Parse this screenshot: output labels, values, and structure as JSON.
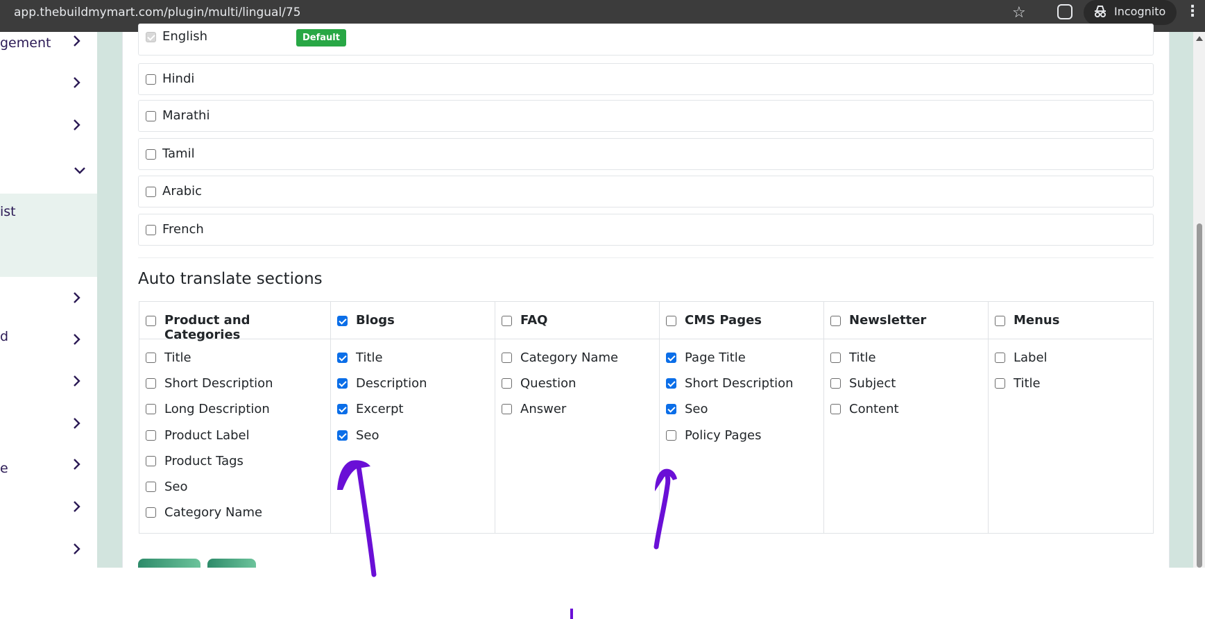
{
  "browser": {
    "url": "app.thebuildmymart.com/plugin/multi/lingual/75",
    "incognito_label": "Incognito"
  },
  "sidebar": {
    "items": [
      {
        "label": "gement"
      },
      {
        "label": ""
      },
      {
        "label": ""
      },
      {
        "label": ""
      },
      {
        "label": "ist"
      },
      {
        "label": ""
      },
      {
        "label": "d"
      },
      {
        "label": ""
      },
      {
        "label": ""
      },
      {
        "label": "e"
      },
      {
        "label": ""
      },
      {
        "label": ""
      }
    ]
  },
  "languages": [
    {
      "label": "English",
      "checked": true,
      "disabled": true,
      "badge": "Default"
    },
    {
      "label": "Hindi",
      "checked": false
    },
    {
      "label": "Marathi",
      "checked": false
    },
    {
      "label": "Tamil",
      "checked": false
    },
    {
      "label": "Arabic",
      "checked": false
    },
    {
      "label": "French",
      "checked": false
    }
  ],
  "auto_translate": {
    "title": "Auto translate sections",
    "columns": [
      {
        "heading": "Product and Categories",
        "checked": false,
        "items": [
          {
            "label": "Title",
            "checked": false
          },
          {
            "label": "Short Description",
            "checked": false
          },
          {
            "label": "Long Description",
            "checked": false
          },
          {
            "label": "Product Label",
            "checked": false
          },
          {
            "label": "Product Tags",
            "checked": false
          },
          {
            "label": "Seo",
            "checked": false
          },
          {
            "label": "Category Name",
            "checked": false
          }
        ]
      },
      {
        "heading": "Blogs",
        "checked": true,
        "items": [
          {
            "label": "Title",
            "checked": true
          },
          {
            "label": "Description",
            "checked": true
          },
          {
            "label": "Excerpt",
            "checked": true
          },
          {
            "label": "Seo",
            "checked": true
          }
        ]
      },
      {
        "heading": "FAQ",
        "checked": false,
        "items": [
          {
            "label": "Category Name",
            "checked": false
          },
          {
            "label": "Question",
            "checked": false
          },
          {
            "label": "Answer",
            "checked": false
          }
        ]
      },
      {
        "heading": "CMS Pages",
        "checked": false,
        "items": [
          {
            "label": "Page Title",
            "checked": true
          },
          {
            "label": "Short Description",
            "checked": true
          },
          {
            "label": "Seo",
            "checked": true
          },
          {
            "label": "Policy Pages",
            "checked": false
          }
        ]
      },
      {
        "heading": "Newsletter",
        "checked": false,
        "items": [
          {
            "label": "Title",
            "checked": false
          },
          {
            "label": "Subject",
            "checked": false
          },
          {
            "label": "Content",
            "checked": false
          }
        ]
      },
      {
        "heading": "Menus",
        "checked": false,
        "items": [
          {
            "label": "Label",
            "checked": false
          },
          {
            "label": "Title",
            "checked": false
          }
        ]
      }
    ]
  },
  "colors": {
    "accent_check": "#0b6ee8",
    "badge_green": "#28a745",
    "annotation_purple": "#6a0fd6",
    "sidebar_text": "#2b1a55"
  }
}
